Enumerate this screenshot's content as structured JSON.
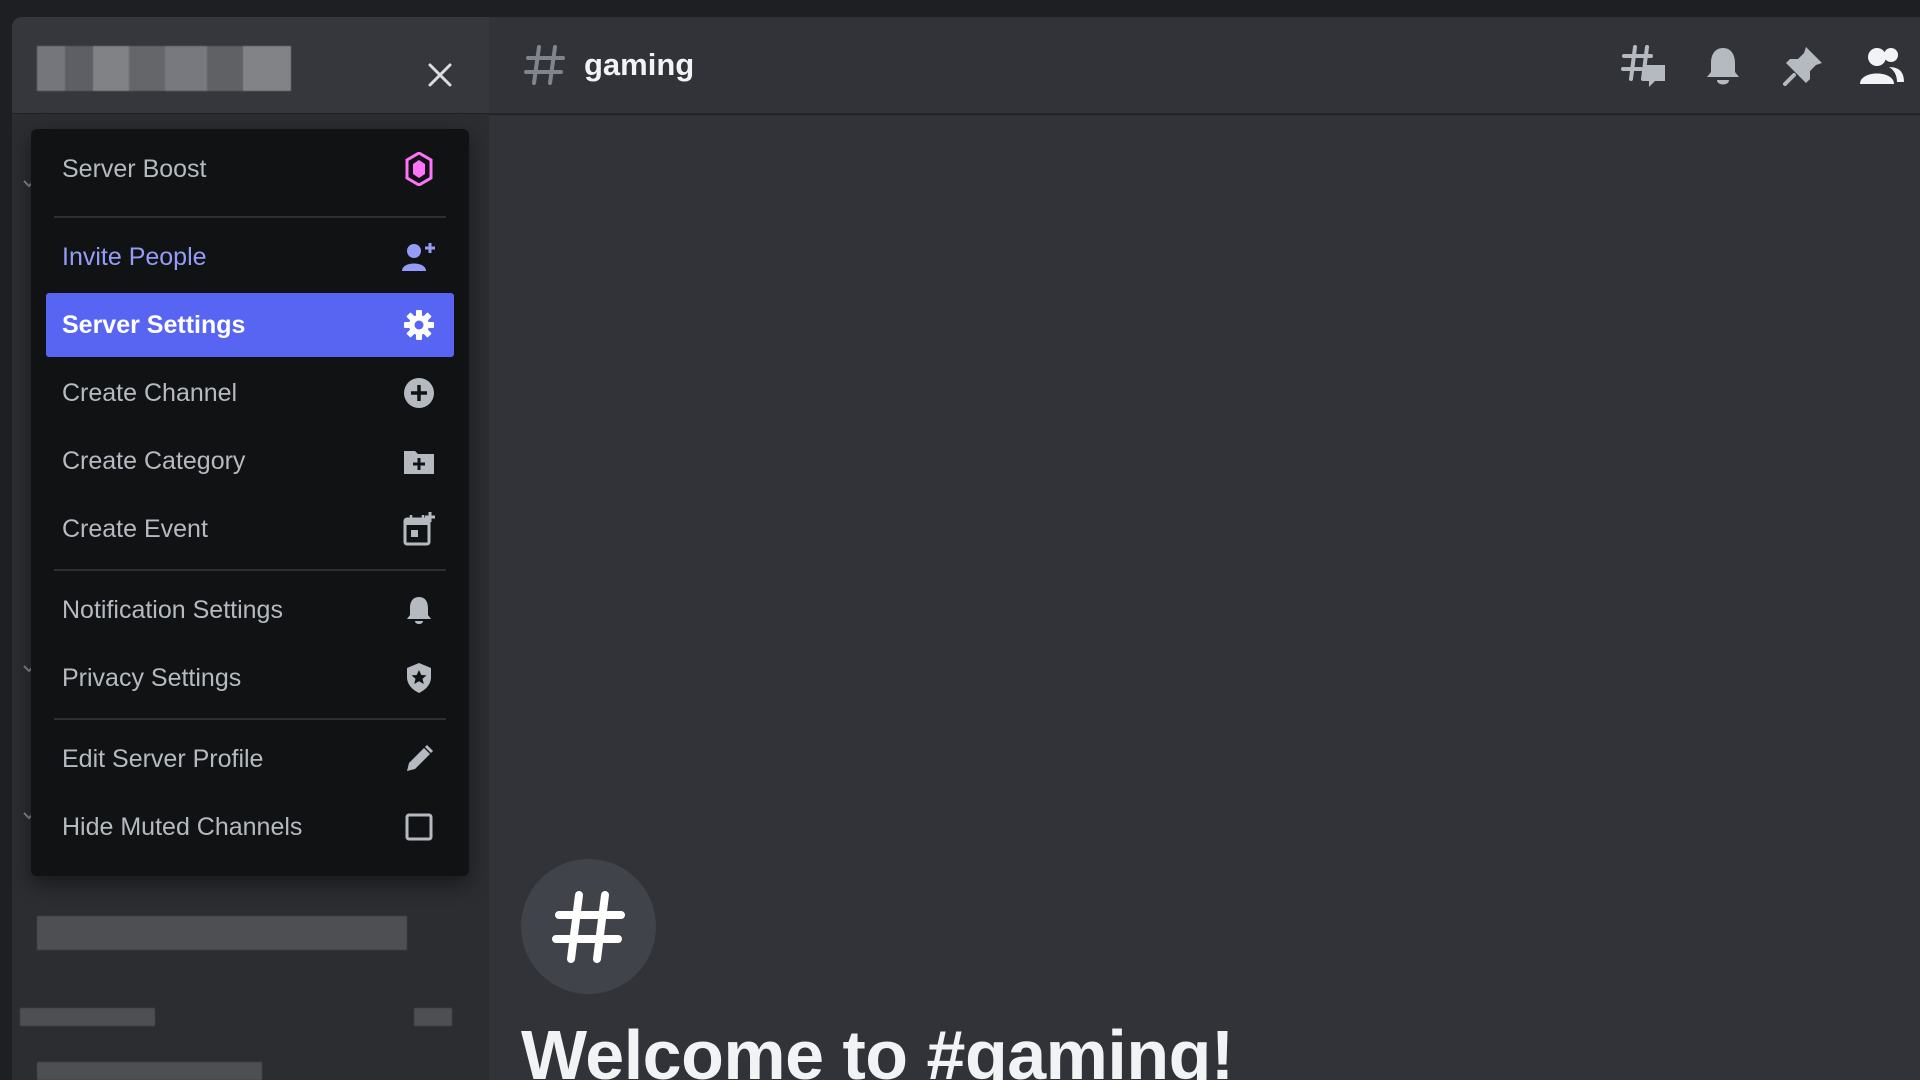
{
  "sidebar": {
    "close_label": "Close"
  },
  "menu": {
    "items": [
      {
        "label": "Server Boost",
        "icon": "boost-gem-icon"
      },
      {
        "label": "Invite People",
        "icon": "add-person-icon"
      },
      {
        "label": "Server Settings",
        "icon": "gear-icon"
      },
      {
        "label": "Create Channel",
        "icon": "plus-circle-icon"
      },
      {
        "label": "Create Category",
        "icon": "folder-plus-icon"
      },
      {
        "label": "Create Event",
        "icon": "calendar-plus-icon"
      },
      {
        "label": "Notification Settings",
        "icon": "bell-icon"
      },
      {
        "label": "Privacy Settings",
        "icon": "shield-star-icon"
      },
      {
        "label": "Edit Server Profile",
        "icon": "pencil-icon"
      },
      {
        "label": "Hide Muted Channels",
        "icon": "checkbox-icon"
      }
    ],
    "active_item": "Server Settings",
    "hide_muted_checked": false
  },
  "topbar": {
    "channel_name": "gaming",
    "icons": [
      "threads-icon",
      "bell-icon",
      "pin-icon",
      "members-icon"
    ]
  },
  "main": {
    "welcome_title": "Welcome to #gaming!"
  },
  "colors": {
    "accent": "#5865f2",
    "invite_text": "#949cf7",
    "boost_pink": "#ff73fa",
    "menu_bg": "#111214",
    "chat_bg": "#313338",
    "sidebar_bg": "#2b2d31"
  }
}
